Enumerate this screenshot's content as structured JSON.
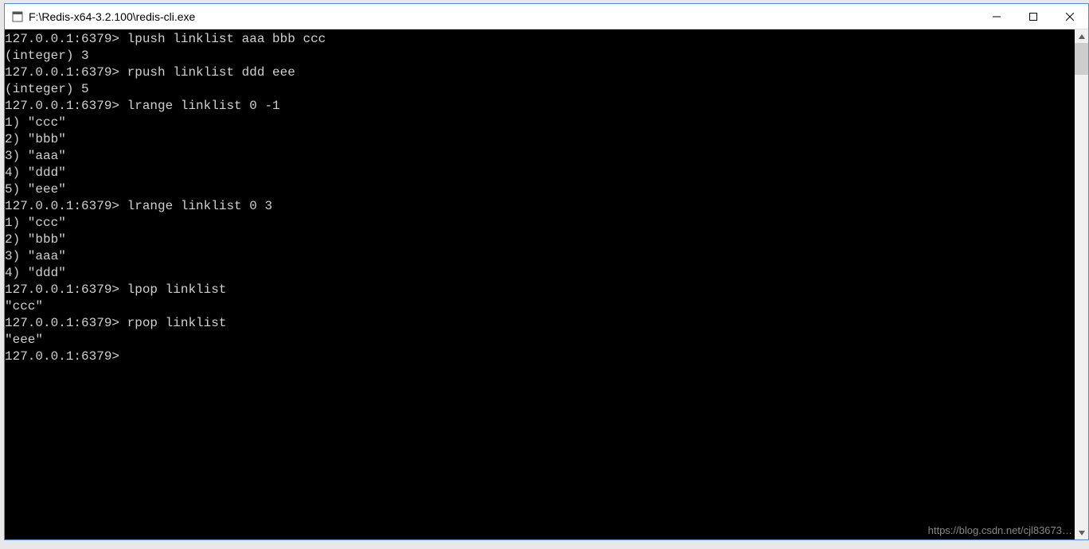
{
  "window": {
    "title": "F:\\Redis-x64-3.2.100\\redis-cli.exe"
  },
  "terminal": {
    "lines": [
      "127.0.0.1:6379> lpush linklist aaa bbb ccc",
      "(integer) 3",
      "127.0.0.1:6379> rpush linklist ddd eee",
      "(integer) 5",
      "127.0.0.1:6379> lrange linklist 0 -1",
      "1) \"ccc\"",
      "2) \"bbb\"",
      "3) \"aaa\"",
      "4) \"ddd\"",
      "5) \"eee\"",
      "127.0.0.1:6379> lrange linklist 0 3",
      "1) \"ccc\"",
      "2) \"bbb\"",
      "3) \"aaa\"",
      "4) \"ddd\"",
      "127.0.0.1:6379> lpop linklist",
      "\"ccc\"",
      "127.0.0.1:6379> rpop linklist",
      "\"eee\"",
      "127.0.0.1:6379>"
    ]
  },
  "watermark": "https://blog.csdn.net/cjl83673…"
}
